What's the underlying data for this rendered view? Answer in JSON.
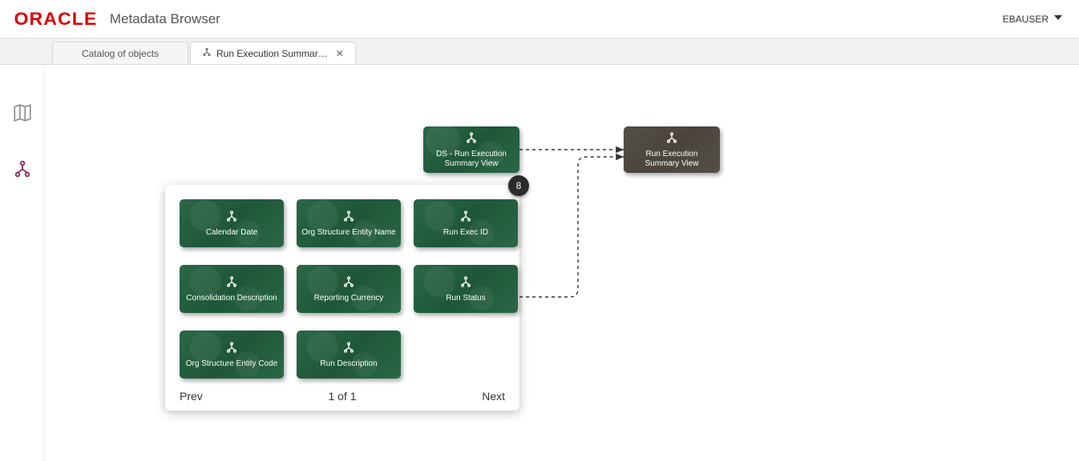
{
  "header": {
    "logo_text": "ORACLE",
    "app_title": "Metadata Browser",
    "user_label": "EBAUSER"
  },
  "tabs": {
    "catalog_label": "Catalog of objects",
    "run_exec_label": "Run Execution Summar…"
  },
  "breadcrumb": {
    "label": "Run Execution Summary…"
  },
  "nodes": {
    "ds_run_exec": "DS - Run Execution Summary View",
    "run_exec_view": "Run Execution Summary View"
  },
  "group": {
    "badge_count": "8",
    "items": [
      "Calendar Date",
      "Org Structure Entity Name",
      "Run Exec ID",
      "Consolidation Description",
      "Reporting Currency",
      "Run Status",
      "Org Structure Entity Code",
      "Run Description"
    ],
    "prev_label": "Prev",
    "page_label": "1 of 1",
    "next_label": "Next"
  }
}
